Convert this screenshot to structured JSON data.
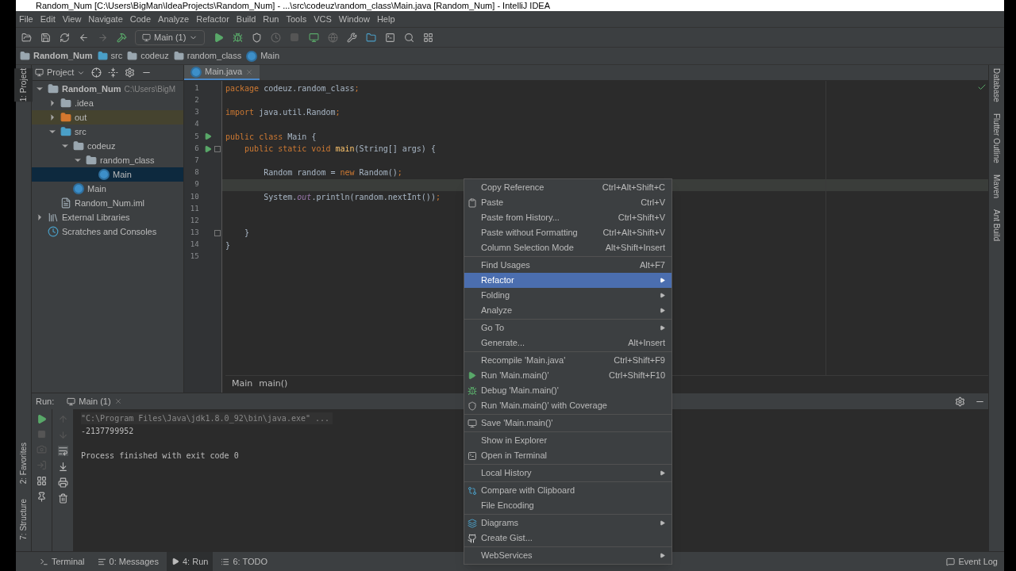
{
  "window": {
    "title": "Random_Num [C:\\Users\\BigMan\\IdeaProjects\\Random_Num] - ...\\src\\codeuz\\random_class\\Main.java [Random_Num] - IntelliJ IDEA"
  },
  "menu_bar": [
    "File",
    "Edit",
    "View",
    "Navigate",
    "Code",
    "Analyze",
    "Refactor",
    "Build",
    "Run",
    "Tools",
    "VCS",
    "Window",
    "Help"
  ],
  "toolbar": {
    "run_config": "Main (1)"
  },
  "breadcrumbs": [
    "Random_Num",
    "src",
    "codeuz",
    "random_class",
    "Main"
  ],
  "left_stripe": [
    {
      "label": "1: Project",
      "selected": true
    },
    {
      "label": "2: Favorites",
      "selected": false
    },
    {
      "label": "7: Structure",
      "selected": false
    }
  ],
  "right_stripe": [
    "Database",
    "Flutter Outline",
    "Maven",
    "Ant Build"
  ],
  "project_panel": {
    "title": "Project",
    "tree": [
      {
        "label": "Random_Num",
        "note": "C:\\Users\\BigM",
        "kind": "module",
        "expanded": true,
        "selected": false,
        "children": [
          {
            "label": ".idea",
            "kind": "folder",
            "expanded": false,
            "selected": false
          },
          {
            "label": "out",
            "kind": "excluded",
            "expanded": false,
            "selected": false
          },
          {
            "label": "src",
            "kind": "source",
            "expanded": true,
            "selected": false,
            "children": [
              {
                "label": "codeuz",
                "kind": "package",
                "expanded": true,
                "selected": false,
                "children": [
                  {
                    "label": "random_class",
                    "kind": "package",
                    "expanded": true,
                    "selected": false,
                    "children": [
                      {
                        "label": "Main",
                        "kind": "class",
                        "selected": true
                      }
                    ]
                  }
                ]
              },
              {
                "label": "Main",
                "kind": "class",
                "selected": false
              }
            ]
          },
          {
            "label": "Random_Num.iml",
            "kind": "file",
            "selected": false
          }
        ]
      },
      {
        "label": "External Libraries",
        "kind": "libraries",
        "expanded": false,
        "selected": false
      },
      {
        "label": "Scratches and Consoles",
        "kind": "scratches",
        "selected": false
      }
    ]
  },
  "editor": {
    "tab": "Main.java",
    "lines": [
      {
        "number": "1",
        "current": false,
        "run_marker": false,
        "fold_marker": false,
        "tokens": [
          {
            "text": "package ",
            "kind": "keyword"
          },
          {
            "text": "codeuz.random_class",
            "kind": "plain"
          },
          {
            "text": ";",
            "kind": "keyword"
          }
        ]
      },
      {
        "number": "2",
        "current": false,
        "run_marker": false,
        "fold_marker": false
      },
      {
        "number": "3",
        "current": false,
        "run_marker": false,
        "fold_marker": false,
        "tokens": [
          {
            "text": "import ",
            "kind": "keyword"
          },
          {
            "text": "java.util.Random",
            "kind": "plain"
          },
          {
            "text": ";",
            "kind": "keyword"
          }
        ]
      },
      {
        "number": "4",
        "current": false,
        "run_marker": false,
        "fold_marker": false
      },
      {
        "number": "5",
        "current": false,
        "run_marker": true,
        "fold_marker": false,
        "tokens": [
          {
            "text": "public class ",
            "kind": "keyword"
          },
          {
            "text": "Main {",
            "kind": "plain"
          }
        ]
      },
      {
        "number": "6",
        "current": false,
        "run_marker": true,
        "fold_marker": true,
        "tokens": [
          {
            "text": "    public static void ",
            "kind": "keyword"
          },
          {
            "text": "main",
            "kind": "method"
          },
          {
            "text": "(String[] args) {",
            "kind": "plain"
          }
        ]
      },
      {
        "number": "7",
        "current": false,
        "run_marker": false,
        "fold_marker": false
      },
      {
        "number": "8",
        "current": false,
        "run_marker": false,
        "fold_marker": false,
        "tokens": [
          {
            "text": "        Random random = ",
            "kind": "plain"
          },
          {
            "text": "new ",
            "kind": "keyword"
          },
          {
            "text": "Random()",
            "kind": "plain"
          },
          {
            "text": ";",
            "kind": "keyword"
          }
        ]
      },
      {
        "number": "9",
        "current": true,
        "run_marker": false,
        "fold_marker": false
      },
      {
        "number": "10",
        "current": false,
        "run_marker": false,
        "fold_marker": false,
        "tokens": [
          {
            "text": "        System.",
            "kind": "plain"
          },
          {
            "text": "out",
            "kind": "field"
          },
          {
            "text": ".println(random.nextInt())",
            "kind": "plain"
          },
          {
            "text": ";",
            "kind": "keyword"
          }
        ]
      },
      {
        "number": "11",
        "current": false,
        "run_marker": false,
        "fold_marker": false
      },
      {
        "number": "12",
        "current": false,
        "run_marker": false,
        "fold_marker": false
      },
      {
        "number": "13",
        "current": false,
        "run_marker": false,
        "fold_marker": true,
        "tokens": [
          {
            "text": "    }",
            "kind": "plain"
          }
        ]
      },
      {
        "number": "14",
        "current": false,
        "run_marker": false,
        "fold_marker": false,
        "tokens": [
          {
            "text": "}",
            "kind": "plain"
          }
        ]
      },
      {
        "number": "15",
        "current": false,
        "run_marker": false,
        "fold_marker": false
      }
    ],
    "breadcrumbs": [
      "Main",
      "main()"
    ]
  },
  "run_panel": {
    "label": "Run:",
    "tab": "Main (1)",
    "console": [
      {
        "text": "\"C:\\Program Files\\Java\\jdk1.8.0_92\\bin\\java.exe\" ...",
        "kind": "command"
      },
      {
        "text": "-2137799952",
        "kind": "output"
      },
      {
        "kind": "blank"
      },
      {
        "text": "Process finished with exit code 0",
        "kind": "output"
      }
    ]
  },
  "context_menu": {
    "groups": [
      [
        {
          "label": "Copy Reference",
          "shortcut": "Ctrl+Alt+Shift+C",
          "submenu": false,
          "selected": false
        },
        {
          "label": "Paste",
          "shortcut": "Ctrl+V",
          "submenu": false,
          "selected": false
        },
        {
          "label": "Paste from History...",
          "shortcut": "Ctrl+Shift+V",
          "submenu": false,
          "selected": false
        },
        {
          "label": "Paste without Formatting",
          "shortcut": "Ctrl+Alt+Shift+V",
          "submenu": false,
          "selected": false
        },
        {
          "label": "Column Selection Mode",
          "shortcut": "Alt+Shift+Insert",
          "submenu": false,
          "selected": false
        }
      ],
      [
        {
          "label": "Find Usages",
          "shortcut": "Alt+F7",
          "submenu": false,
          "selected": false
        },
        {
          "label": "Refactor",
          "submenu": true,
          "selected": true
        },
        {
          "label": "Folding",
          "submenu": true,
          "selected": false
        },
        {
          "label": "Analyze",
          "submenu": true,
          "selected": false
        }
      ],
      [
        {
          "label": "Go To",
          "submenu": true,
          "selected": false
        },
        {
          "label": "Generate...",
          "shortcut": "Alt+Insert",
          "submenu": false,
          "selected": false
        }
      ],
      [
        {
          "label": "Recompile 'Main.java'",
          "shortcut": "Ctrl+Shift+F9",
          "submenu": false,
          "selected": false
        },
        {
          "label": "Run 'Main.main()'",
          "shortcut": "Ctrl+Shift+F10",
          "submenu": false,
          "selected": false
        },
        {
          "label": "Debug 'Main.main()'",
          "submenu": false,
          "selected": false
        },
        {
          "label": "Run 'Main.main()' with Coverage",
          "submenu": false,
          "selected": false
        }
      ],
      [
        {
          "label": "Save 'Main.main()'",
          "submenu": false,
          "selected": false
        }
      ],
      [
        {
          "label": "Show in Explorer",
          "submenu": false,
          "selected": false
        },
        {
          "label": "Open in Terminal",
          "submenu": false,
          "selected": false
        }
      ],
      [
        {
          "label": "Local History",
          "submenu": true,
          "selected": false
        }
      ],
      [
        {
          "label": "Compare with Clipboard",
          "submenu": false,
          "selected": false
        },
        {
          "label": "File Encoding",
          "submenu": false,
          "selected": false
        }
      ],
      [
        {
          "label": "Diagrams",
          "submenu": true,
          "selected": false
        },
        {
          "label": "Create Gist...",
          "submenu": false,
          "selected": false
        }
      ],
      [
        {
          "label": "WebServices",
          "submenu": true,
          "selected": false
        }
      ]
    ]
  },
  "status_bar": {
    "tabs": [
      {
        "label": "Terminal",
        "selected": false
      },
      {
        "label": "0: Messages",
        "selected": false
      },
      {
        "label": "4: Run",
        "selected": true
      },
      {
        "label": "6: TODO",
        "selected": false
      }
    ],
    "event_log": "Event Log"
  }
}
